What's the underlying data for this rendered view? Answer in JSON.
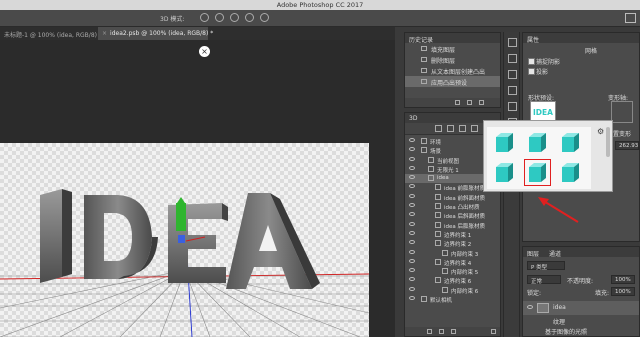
{
  "app": {
    "title": "Adobe Photoshop CC 2017"
  },
  "options_bar": {
    "mode_label": "3D 模式:"
  },
  "tabs": [
    {
      "label": "未标题-1 @ 100% (idea, RGB/8) *"
    },
    {
      "label": "idea2.psb @ 100% (idea, RGB/8) *"
    }
  ],
  "history": {
    "title": "历史记录",
    "items": [
      {
        "label": "填充图层"
      },
      {
        "label": "删除图层"
      },
      {
        "label": "从文本图层创建凸出"
      },
      {
        "label": "应用凸出预设"
      }
    ]
  },
  "panel3d": {
    "title": "3D",
    "tree": [
      {
        "label": "环境",
        "indent": 0
      },
      {
        "label": "场景",
        "indent": 0
      },
      {
        "label": "当前视图",
        "indent": 1
      },
      {
        "label": "无限光 1",
        "indent": 1
      },
      {
        "label": "idea",
        "indent": 1
      },
      {
        "label": "idea 前膨胀材质",
        "indent": 2
      },
      {
        "label": "idea 前斜面材质",
        "indent": 2
      },
      {
        "label": "idea 凸出材质",
        "indent": 2
      },
      {
        "label": "idea 后斜面材质",
        "indent": 2
      },
      {
        "label": "idea 后膨胀材质",
        "indent": 2
      },
      {
        "label": "边界约束 1",
        "indent": 2
      },
      {
        "label": "边界约束 2",
        "indent": 2
      },
      {
        "label": "内部约束 3",
        "indent": 3
      },
      {
        "label": "边界约束 4",
        "indent": 2
      },
      {
        "label": "内部约束 5",
        "indent": 3
      },
      {
        "label": "边界约束 6",
        "indent": 2
      },
      {
        "label": "内部约束 6",
        "indent": 3
      },
      {
        "label": "默认相机",
        "indent": 0
      }
    ]
  },
  "properties": {
    "title": "属性",
    "tab_label": "网格",
    "catch_shadow": "捕捉阴影",
    "cast_shadow": "投影",
    "shape_preset_label": "形状预设:",
    "deform_axis_label": "变形轴:",
    "preset_preview_text": "IDEA",
    "depth_value": "262.93",
    "reset_deform": "重置变形"
  },
  "layers": {
    "tab1": "图层",
    "tab2": "通道",
    "kind_label": "P 类型",
    "blend_mode": "正常",
    "opacity_label": "不透明度:",
    "opacity_value": "100%",
    "lock_label": "锁定:",
    "fill_label": "填充:",
    "fill_value": "100%",
    "layer_name": "idea",
    "sub1": "纹理",
    "sub2": "基于图像的光照"
  },
  "canvas": {
    "text": "IDEA"
  },
  "preset_popup": {
    "selected_index": 4,
    "cube_color": "#2ec9c2"
  },
  "colors": {
    "accent_red": "#e02020"
  }
}
